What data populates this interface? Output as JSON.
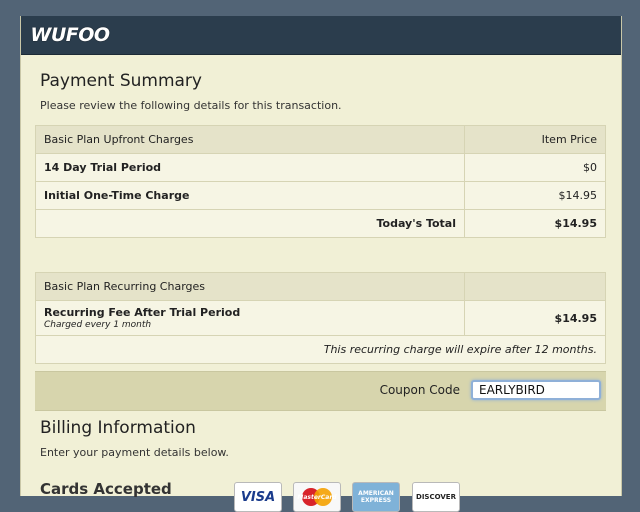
{
  "header": {
    "logo_text": "WUFOO"
  },
  "payment_summary": {
    "title": "Payment Summary",
    "subtitle": "Please review the following details for this transaction."
  },
  "upfront": {
    "header_label": "Basic Plan Upfront Charges",
    "header_price": "Item Price",
    "rows": [
      {
        "label": "14 Day Trial Period",
        "price": "$0"
      },
      {
        "label": "Initial One-Time Charge",
        "price": "$14.95"
      }
    ],
    "total_label": "Today's Total",
    "total_value": "$14.95"
  },
  "recurring": {
    "header_label": "Basic Plan Recurring Charges",
    "fee_label": "Recurring Fee After Trial Period",
    "fee_note": "Charged every 1 month",
    "fee_value": "$14.95",
    "expiry_note": "This recurring charge will expire after 12 months."
  },
  "coupon": {
    "label": "Coupon Code",
    "value": "EARLYBIRD"
  },
  "billing": {
    "title": "Billing Information",
    "subtitle": "Enter your payment details below.",
    "cards_title": "Cards Accepted",
    "cards": [
      {
        "name": "VISA",
        "icon": "visa-card-icon"
      },
      {
        "name": "MasterCard",
        "icon": "mastercard-icon"
      },
      {
        "name": "AMERICAN EXPRESS",
        "icon": "amex-card-icon"
      },
      {
        "name": "DISCOVER",
        "icon": "discover-card-icon"
      }
    ]
  },
  "colors": {
    "page_bg": "#526476",
    "panel_bg": "#f1f0d6",
    "header_bg": "#2b3d4d",
    "coupon_bar": "#d7d5ad"
  }
}
